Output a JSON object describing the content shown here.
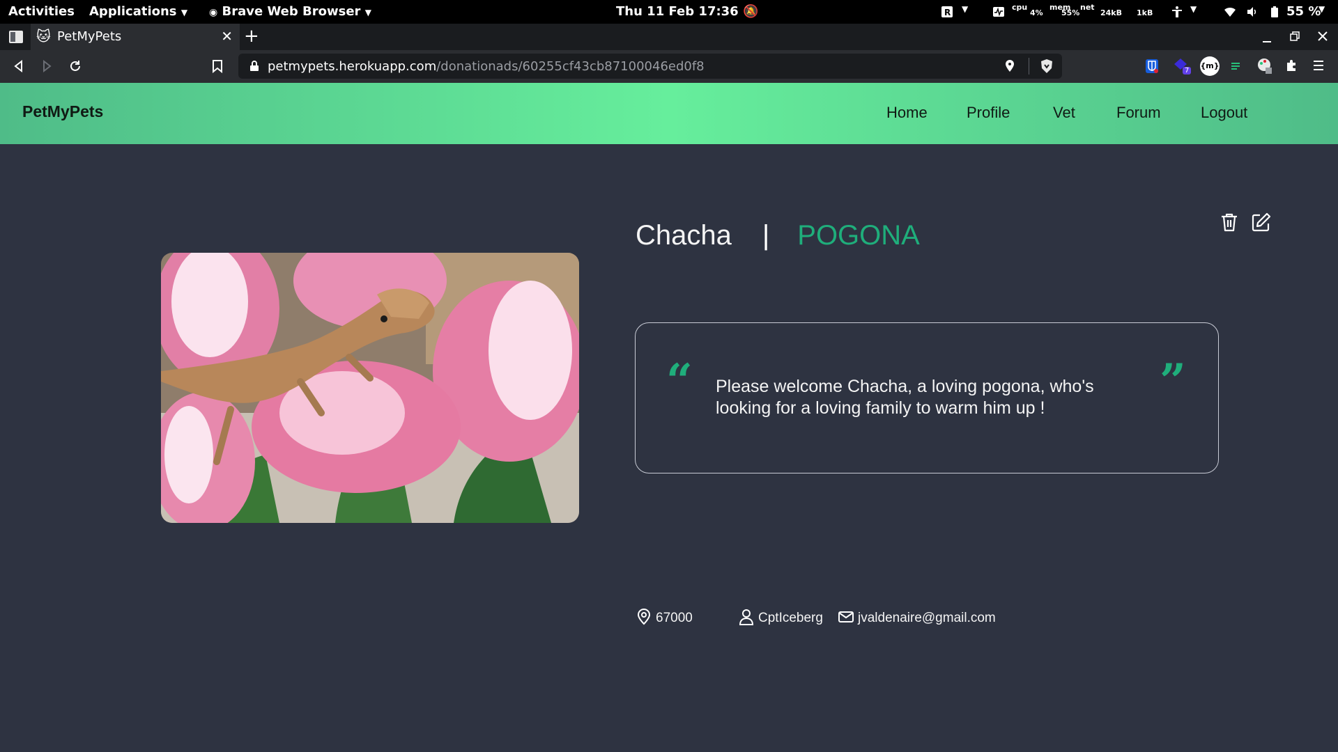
{
  "system_bar": {
    "activities": "Activities",
    "applications": "Applications",
    "active_app": "Brave Web Browser",
    "clock": "Thu 11 Feb  17:36",
    "cpu_label": "cpu",
    "cpu_value": "4%",
    "mem_label": "mem",
    "mem_value": "55%",
    "net_label": "net",
    "net_down": "24kB",
    "net_up": "1kB",
    "battery": "55 %"
  },
  "browser": {
    "tab_title": "PetMyPets",
    "new_tab": "+",
    "url_host": "petmypets.herokuapp.com",
    "url_path": "/donationads/60255cf43cb87100046ed0f8",
    "extension_badge": "7",
    "extension_label": "{m}"
  },
  "site": {
    "brand": "PetMyPets",
    "nav": [
      "Home",
      "Profile",
      "Vet",
      "Forum",
      "Logout"
    ]
  },
  "pet": {
    "name": "Chacha",
    "separator": "|",
    "species": "POGONA",
    "description": "Please welcome Chacha, a loving pogona, who's looking for a loving family to warm him up !",
    "open_quote": "“",
    "close_quote": "”",
    "postal_code": "67000",
    "owner": "CptIceberg",
    "email": "jvaldenaire@gmail.com"
  },
  "colors": {
    "accent": "#1fae7b",
    "navbar_center": "#66ee9c",
    "navbar_edge": "#4fbc88",
    "page_background": "#2e3341"
  }
}
